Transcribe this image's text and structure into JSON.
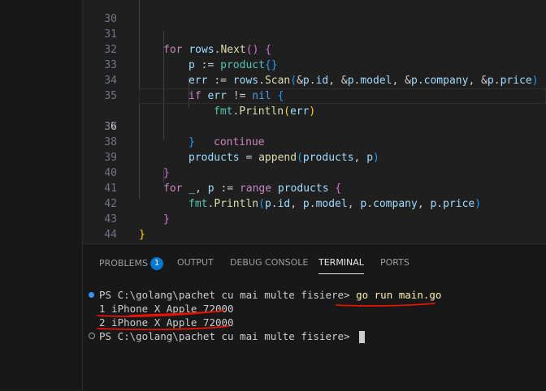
{
  "editor": {
    "current_line": "36",
    "lines": [
      {
        "n": "30",
        "t": ""
      },
      {
        "n": "31",
        "t": "for rows.Next() {"
      },
      {
        "n": "32",
        "t": "p := product{}"
      },
      {
        "n": "33",
        "t": "err := rows.Scan(&p.id, &p.model, &p.company, &p.price)"
      },
      {
        "n": "34",
        "t": "if err != nil {"
      },
      {
        "n": "35",
        "t": "fmt.Println(err)"
      },
      {
        "n": "36",
        "t": "continue"
      },
      {
        "n": "37",
        "t": "}"
      },
      {
        "n": "38",
        "t": "products = append(products, p)"
      },
      {
        "n": "39",
        "t": "}"
      },
      {
        "n": "40",
        "t": "for _, p := range products {"
      },
      {
        "n": "41",
        "t": "fmt.Println(p.id, p.model, p.company, p.price)"
      },
      {
        "n": "42",
        "t": "}"
      },
      {
        "n": "43",
        "t": "}"
      },
      {
        "n": "44",
        "t": ""
      }
    ]
  },
  "panel": {
    "tabs": [
      {
        "label": "PROBLEMS",
        "badge": "1"
      },
      {
        "label": "OUTPUT"
      },
      {
        "label": "DEBUG CONSOLE"
      },
      {
        "label": "TERMINAL",
        "active": true
      },
      {
        "label": "PORTS"
      }
    ]
  },
  "terminal": {
    "prompt1": "PS C:\\golang\\pachet cu mai multe fisiere> ",
    "command": "go run main.go",
    "output1": "1 iPhone X Apple 72000",
    "output2": "2 iPhone X Apple 72000",
    "prompt2": "PS C:\\golang\\pachet cu mai multe fisiere> "
  },
  "colors": {
    "annotation": "#e51400",
    "accent": "#0078d4"
  }
}
